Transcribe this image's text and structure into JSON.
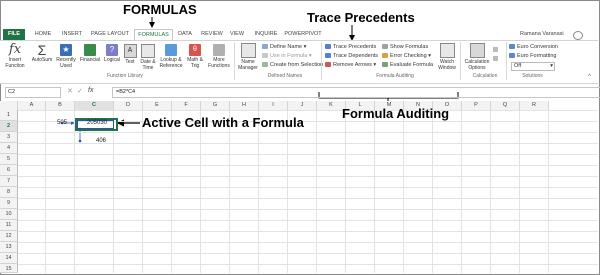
{
  "annotations": {
    "formulas": "FORMULAS",
    "trace_precedents": "Trace Precedents",
    "active_cell": "Active Cell with a Formula",
    "formula_auditing": "Formula Auditing"
  },
  "tabs": [
    "FILE",
    "HOME",
    "INSERT",
    "PAGE LAYOUT",
    "FORMULAS",
    "DATA",
    "REVIEW",
    "VIEW",
    "INQUIRE",
    "POWERPIVOT"
  ],
  "user_name": "Ramana Varanasi",
  "ribbon": {
    "function_library": {
      "label": "Function Library",
      "insert_function": [
        "Insert",
        "Function"
      ],
      "autosum": [
        "AutoSum"
      ],
      "recently_used": [
        "Recently",
        "Used"
      ],
      "financial": [
        "Financial"
      ],
      "logical": [
        "Logical"
      ],
      "text": [
        "Text"
      ],
      "date_time": [
        "Date &",
        "Time"
      ],
      "lookup_reference": [
        "Lookup &",
        "Reference"
      ],
      "math_trig": [
        "Math &",
        "Trig"
      ],
      "more_functions": [
        "More",
        "Functions"
      ]
    },
    "defined_names": {
      "label": "Defined Names",
      "name_manager": [
        "Name",
        "Manager"
      ],
      "define_name": "Define Name",
      "use_in_formula": "Use in Formula",
      "create_from_selection": "Create from Selection"
    },
    "formula_auditing": {
      "label": "Formula Auditing",
      "trace_precedents": "Trace Precedents",
      "trace_dependents": "Trace Dependents",
      "remove_arrows": "Remove Arrows",
      "show_formulas": "Show Formulas",
      "error_checking": "Error Checking",
      "evaluate_formula": "Evaluate Formula",
      "watch_window": [
        "Watch",
        "Window"
      ]
    },
    "calculation": {
      "label": "Calculation",
      "calculation_options": [
        "Calculation",
        "Options"
      ]
    },
    "solutions": {
      "label": "Solutions",
      "euro_conversion": "Euro Conversion",
      "euro_formatting": "Euro Formatting",
      "off_value": "Off"
    }
  },
  "formula_bar": {
    "name_box": "C2",
    "formula": "=B2*C4"
  },
  "grid": {
    "columns": [
      "A",
      "B",
      "C",
      "D",
      "E",
      "F",
      "G",
      "H",
      "I",
      "J",
      "K",
      "L",
      "M",
      "N",
      "O",
      "P",
      "Q",
      "R"
    ],
    "rows": [
      "1",
      "2",
      "3",
      "4",
      "5",
      "6",
      "7",
      "8",
      "9",
      "10",
      "11",
      "12",
      "13",
      "14",
      "15"
    ],
    "b2": "505",
    "c2": "205030",
    "c4": "406"
  },
  "colors": {
    "excel_green": "#217346",
    "trace_arrow_blue": "#2c52b8"
  }
}
